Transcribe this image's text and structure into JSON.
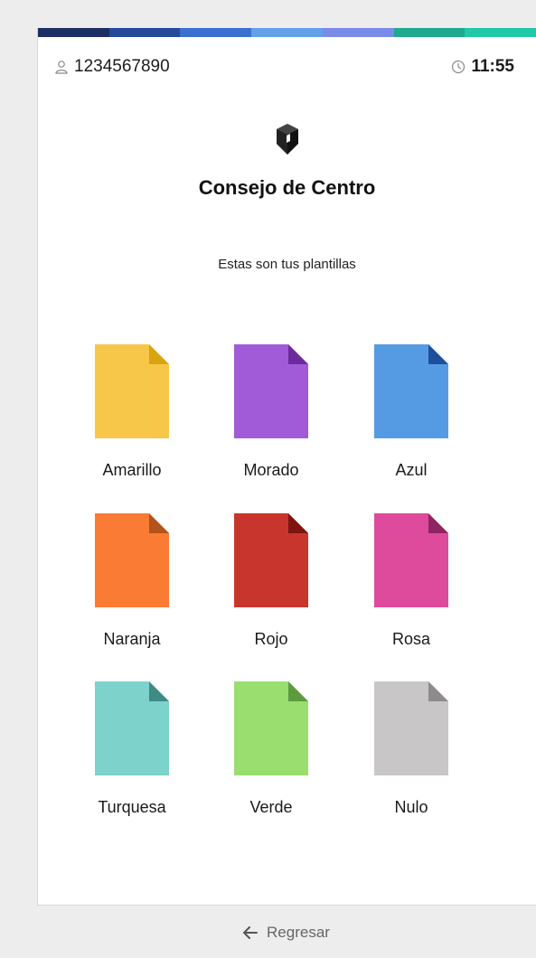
{
  "header": {
    "stripe_colors": [
      "#1c2e63",
      "#264a9a",
      "#3b6fd0",
      "#62a0e8",
      "#7b8be8",
      "#1fa98f",
      "#22c9a7"
    ],
    "user_id": "1234567890",
    "time": "11:55",
    "user_icon": "user-icon",
    "clock_icon": "clock-icon"
  },
  "title": "Consejo de Centro",
  "subtitle": "Estas son tus plantillas",
  "templates": [
    {
      "label": "Amarillo",
      "color": "#f7c74a",
      "fold": "#d9a411"
    },
    {
      "label": "Morado",
      "color": "#a15bd9",
      "fold": "#6d2a9e"
    },
    {
      "label": "Azul",
      "color": "#559be4",
      "fold": "#1e4f9a"
    },
    {
      "label": "Naranja",
      "color": "#fa7b33",
      "fold": "#b3521b"
    },
    {
      "label": "Rojo",
      "color": "#c8352c",
      "fold": "#7e1410"
    },
    {
      "label": "Rosa",
      "color": "#de4a9c",
      "fold": "#8e2460"
    },
    {
      "label": "Turquesa",
      "color": "#7dd2cb",
      "fold": "#3e8b85"
    },
    {
      "label": "Verde",
      "color": "#99de6f",
      "fold": "#5e9a3e"
    },
    {
      "label": "Nulo",
      "color": "#c8c6c7",
      "fold": "#8d8b8c"
    }
  ],
  "footer": {
    "back_label": "Regresar",
    "back_icon": "arrow-left-icon"
  }
}
